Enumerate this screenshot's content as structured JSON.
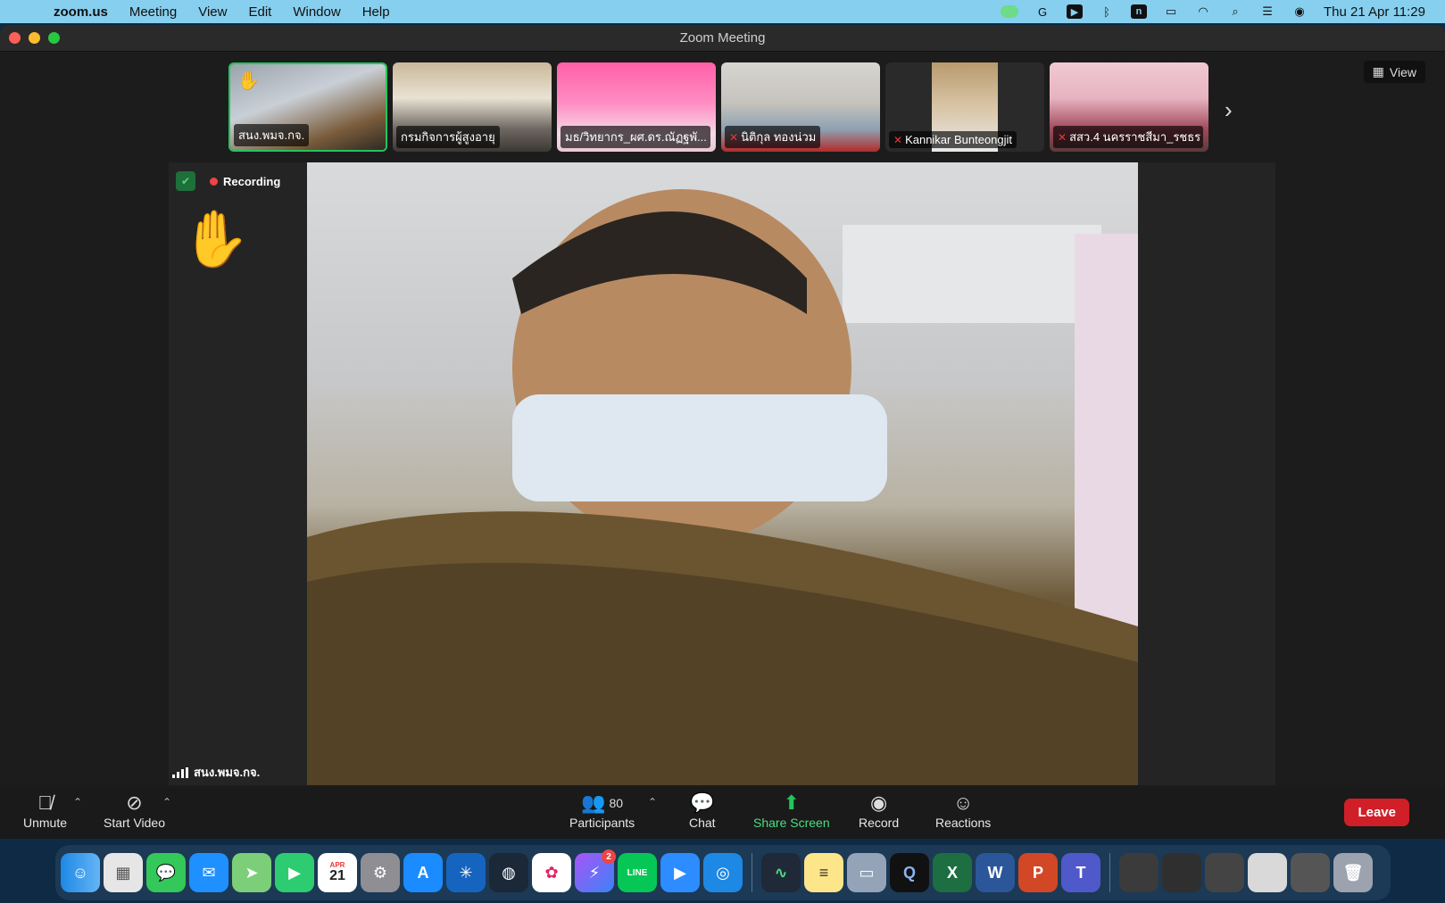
{
  "menubar": {
    "app": "zoom.us",
    "items": [
      "Meeting",
      "View",
      "Edit",
      "Window",
      "Help"
    ],
    "clock": "Thu 21 Apr  11:29"
  },
  "window": {
    "title": "Zoom Meeting"
  },
  "gallery": {
    "view_label": "View",
    "participants": [
      {
        "name": "สนง.พมจ.กจ.",
        "active": true,
        "hand": true,
        "muted": false
      },
      {
        "name": "กรมกิจการผู้สูงอายุ",
        "active": false,
        "hand": false,
        "muted": false
      },
      {
        "name": "มธ/วิทยากร_ผศ.ดร.ณัฏฐพั...",
        "active": false,
        "hand": false,
        "muted": false
      },
      {
        "name": "นิติกุล ทองน่วม",
        "active": false,
        "hand": false,
        "muted": true
      },
      {
        "name": "Kannikar Bunteongjit",
        "active": false,
        "hand": false,
        "muted": true
      },
      {
        "name": "สสว.4 นครราชสีมา_รชธร",
        "active": false,
        "hand": false,
        "muted": true
      }
    ]
  },
  "stage": {
    "recording_label": "Recording",
    "speaker_name": "สนง.พมจ.กจ."
  },
  "toolbar": {
    "unmute": "Unmute",
    "start_video": "Start Video",
    "participants": "Participants",
    "participants_count": "80",
    "chat": "Chat",
    "share_screen": "Share Screen",
    "record": "Record",
    "reactions": "Reactions",
    "leave": "Leave"
  },
  "dock": {
    "calendar_month": "APR",
    "calendar_day": "21",
    "messenger_badge": "2"
  }
}
